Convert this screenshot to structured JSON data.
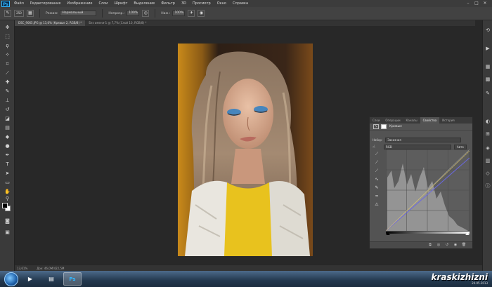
{
  "app": {
    "logo": "Ps"
  },
  "menu": [
    "Файл",
    "Редактирование",
    "Изображение",
    "Слои",
    "Шрифт",
    "Выделение",
    "Фильтр",
    "3D",
    "Просмотр",
    "Окно",
    "Справка"
  ],
  "window_controls": [
    "–",
    "□",
    "✕"
  ],
  "options": {
    "brush_size": "250",
    "mode_label": "Режим:",
    "mode_value": "Нормальный",
    "opacity_label": "Непрозр.:",
    "opacity_value": "100%",
    "flow_label": "Наж.:",
    "flow_value": "100%"
  },
  "tabs": [
    {
      "label": "DSC_9065.JPG @ 13,6% (Кривые 2, RGB/8) *",
      "active": true
    },
    {
      "label": "Без имени-1 @ 7,7% (Слой 10, RGB/8) *",
      "active": false
    }
  ],
  "status": {
    "zoom": "13,61%",
    "doc": "Док: 46,0M/422,5M"
  },
  "panel": {
    "tabs": [
      "Слои",
      "Операции",
      "Каналы",
      "Свойства",
      "История"
    ],
    "active_tab": 3,
    "title": "Кривые",
    "preset_label": "Набор:",
    "preset_value": "Заказная",
    "channel_value": "RGB",
    "auto_button": "Авто"
  },
  "taskbar": {
    "watermark": "kraskizhizni",
    "date": "24.05.2013"
  },
  "colors": {
    "accent": "#33b7ff",
    "panel_bg": "#535353",
    "app_bg": "#282828"
  },
  "icons": {
    "tools": [
      "move-icon",
      "marquee-icon",
      "lasso-icon",
      "quick-select-icon",
      "crop-icon",
      "eyedropper-icon",
      "healing-icon",
      "brush-icon",
      "stamp-icon",
      "history-brush-icon",
      "eraser-icon",
      "gradient-icon",
      "blur-icon",
      "dodge-icon",
      "pen-icon",
      "type-icon",
      "path-select-icon",
      "shape-icon",
      "hand-icon",
      "zoom-icon"
    ],
    "dock": [
      "history-panel-icon",
      "actions-panel-icon",
      "swatches-panel-icon",
      "adjustments-panel-icon",
      "properties-panel-icon",
      "layers-panel-icon",
      "channels-panel-icon",
      "paths-panel-icon"
    ]
  }
}
